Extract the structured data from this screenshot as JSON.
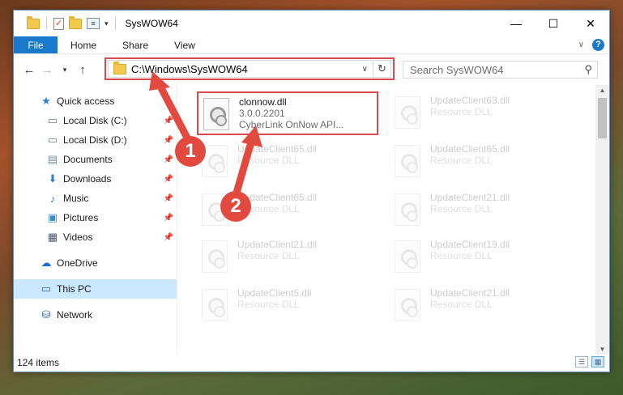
{
  "window": {
    "title": "SysWOW64"
  },
  "window_controls": {
    "minimize": "—",
    "maximize": "☐",
    "close": "✕"
  },
  "ribbon": {
    "tabs": [
      "File",
      "Home",
      "Share",
      "View"
    ],
    "help": "?"
  },
  "address": {
    "path": "C:\\Windows\\SysWOW64"
  },
  "search": {
    "placeholder": "Search SysWOW64"
  },
  "nav": {
    "quick_access": "Quick access",
    "items": [
      "Local Disk (C:)",
      "Local Disk (D:)",
      "Documents",
      "Downloads",
      "Music",
      "Pictures",
      "Videos"
    ],
    "onedrive": "OneDrive",
    "this_pc": "This PC",
    "network": "Network"
  },
  "files": {
    "highlighted": {
      "name": "clonnow.dll",
      "version": "3.0.0.2201",
      "desc": "CyberLink OnNow API..."
    },
    "faded": [
      {
        "name": "UpdateClient63.dll",
        "sub": "Resource DLL"
      },
      {
        "name": "UpdateClient65.dll",
        "sub": "Resource DLL"
      },
      {
        "name": "UpdateClient65.dll",
        "sub": "Resource DLL"
      },
      {
        "name": "UpdateClient65.dll",
        "sub": "Resource DLL"
      },
      {
        "name": "UpdateClient21.dll",
        "sub": "Resource DLL"
      },
      {
        "name": "UpdateClient21.dll",
        "sub": "Resource DLL"
      },
      {
        "name": "UpdateClient19.dll",
        "sub": "Resource DLL"
      },
      {
        "name": "UpdateClient5.dll",
        "sub": "Resource DLL"
      },
      {
        "name": "UpdateClient21.dll",
        "sub": "Resource DLL"
      }
    ]
  },
  "status": {
    "count": "124 items"
  },
  "annotations": {
    "one": "1",
    "two": "2",
    "color": "#e24a3f"
  }
}
